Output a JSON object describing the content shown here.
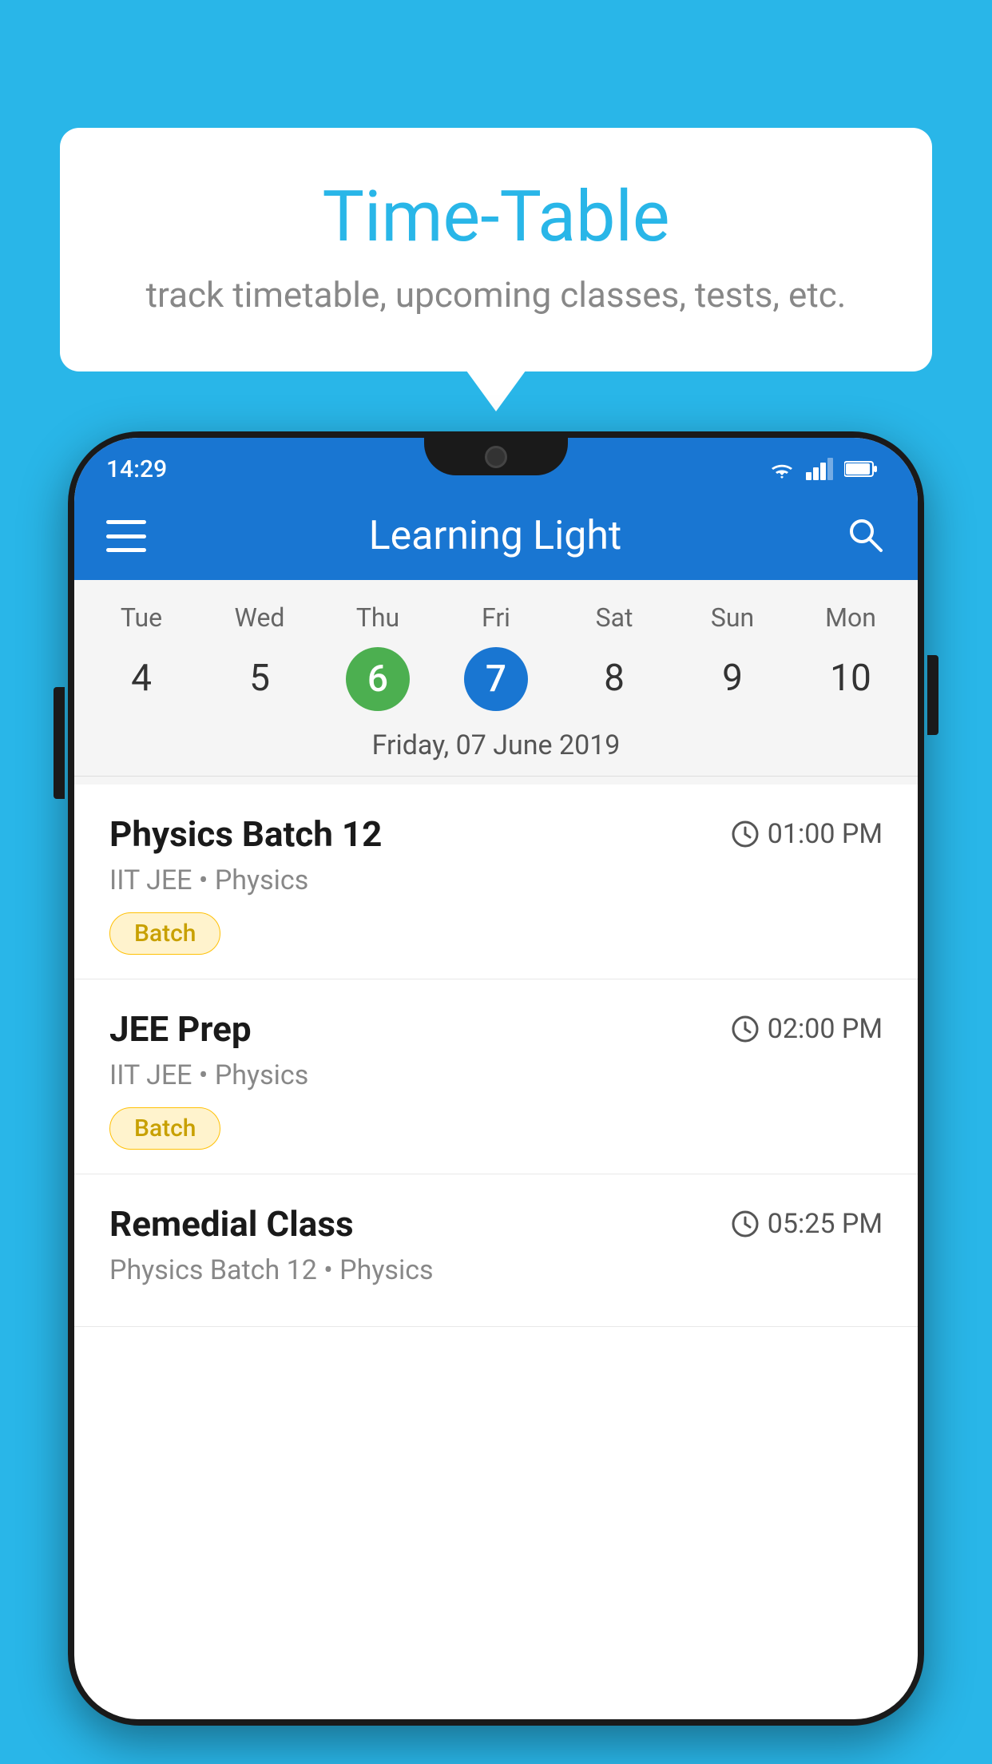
{
  "background": {
    "color": "#29b6e8"
  },
  "speech_bubble": {
    "title": "Time-Table",
    "subtitle": "track timetable, upcoming classes, tests, etc."
  },
  "phone": {
    "status_bar": {
      "time": "14:29"
    },
    "app_bar": {
      "title": "Learning Light",
      "menu_aria": "menu",
      "search_aria": "search"
    },
    "calendar": {
      "days": [
        "Tue",
        "Wed",
        "Thu",
        "Fri",
        "Sat",
        "Sun",
        "Mon"
      ],
      "dates": [
        "4",
        "5",
        "6",
        "7",
        "8",
        "9",
        "10"
      ],
      "today_index": 2,
      "selected_index": 3,
      "selected_label": "Friday, 07 June 2019"
    },
    "classes": [
      {
        "name": "Physics Batch 12",
        "time": "01:00 PM",
        "subtitle": "IIT JEE • Physics",
        "tag": "Batch"
      },
      {
        "name": "JEE Prep",
        "time": "02:00 PM",
        "subtitle": "IIT JEE • Physics",
        "tag": "Batch"
      },
      {
        "name": "Remedial Class",
        "time": "05:25 PM",
        "subtitle": "Physics Batch 12 • Physics",
        "tag": ""
      }
    ]
  }
}
